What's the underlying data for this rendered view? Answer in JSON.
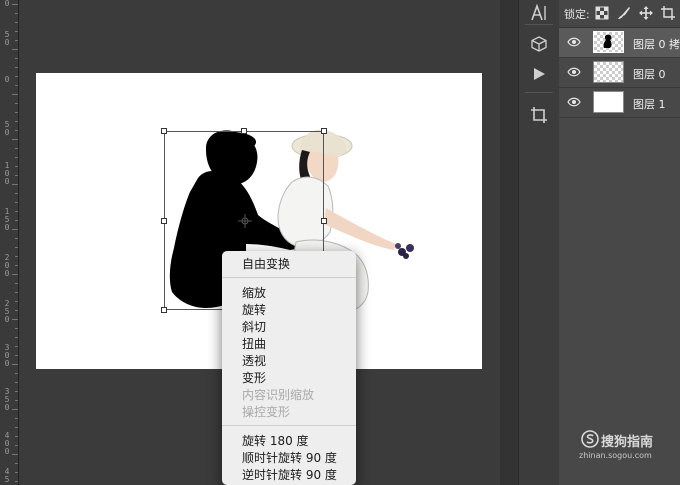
{
  "ruler": {
    "labels": [
      "0",
      "5\n0",
      "0",
      "5\n0",
      "1\n0\n0",
      "1\n5\n0",
      "2\n0\n0",
      "2\n5\n0",
      "3\n0\n0",
      "3\n5\n0",
      "4\n0\n0",
      "4\n5"
    ]
  },
  "context_menu": {
    "free_transform": "自由变换",
    "scale": "缩放",
    "rotate": "旋转",
    "skew": "斜切",
    "distort": "扭曲",
    "perspective": "透视",
    "warp": "变形",
    "content_aware_scale": "内容识别缩放",
    "puppet_warp": "操控变形",
    "rotate_180": "旋转 180 度",
    "rotate_90_cw": "顺时针旋转 90 度",
    "rotate_90_ccw": "逆时针旋转 90 度"
  },
  "layers_panel": {
    "lock_label": "锁定:",
    "layers": [
      {
        "name": "图层 0 拷",
        "thumb": "silhouette",
        "selected": true
      },
      {
        "name": "图层 0",
        "thumb": "transparent",
        "selected": false
      },
      {
        "name": "图层 1",
        "thumb": "white",
        "selected": false
      }
    ]
  },
  "watermark": {
    "brand": "搜狗指南",
    "domain": "zhinan.sogou.com"
  },
  "colors": {
    "panel_bg": "#484848",
    "canvas_bg": "#3b3b3b",
    "menu_bg": "#eeeeee",
    "disabled_text": "#a9a9a9"
  }
}
